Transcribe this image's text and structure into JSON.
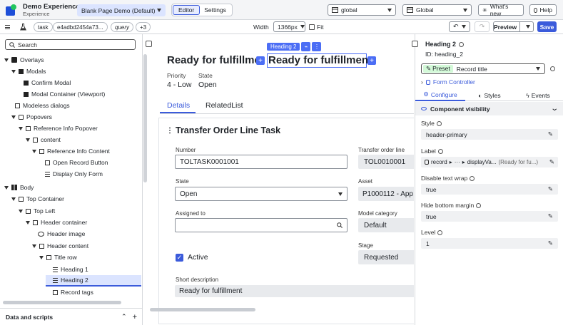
{
  "app": {
    "title": "Demo Experience",
    "subtitle": "Experience"
  },
  "page_selector": "Blank Page Demo (Default)",
  "mode_tabs": {
    "editor": "Editor",
    "settings": "Settings"
  },
  "header_right": {
    "scope_global": "global",
    "app_global": "Global",
    "whats_new": "What's new",
    "help": "Help"
  },
  "toolbar": {
    "chips": [
      "task",
      "e4adbd2454a73...",
      "query",
      "+3"
    ],
    "width_label": "Width",
    "width_value": "1366px",
    "fit_label": "Fit",
    "preview": "Preview",
    "save": "Save"
  },
  "sidebar": {
    "search_placeholder": "Search",
    "tree": [
      {
        "label": "Overlays",
        "level": 0
      },
      {
        "label": "Modals",
        "level": 1
      },
      {
        "label": "Confirm Modal",
        "level": 2
      },
      {
        "label": "Modal Container (Viewport)",
        "level": 2
      },
      {
        "label": "Modeless dialogs",
        "level": 1
      },
      {
        "label": "Popovers",
        "level": 1
      },
      {
        "label": "Reference Info Popover",
        "level": 2
      },
      {
        "label": "content",
        "level": 3
      },
      {
        "label": "Reference Info Content",
        "level": 4
      },
      {
        "label": "Open Record Button",
        "level": 5
      },
      {
        "label": "Display Only Form",
        "level": 5
      },
      {
        "label": "Body",
        "level": 0
      },
      {
        "label": "Top Container",
        "level": 1
      },
      {
        "label": "Top Left",
        "level": 2
      },
      {
        "label": "Header container",
        "level": 3
      },
      {
        "label": "Header image",
        "level": 4
      },
      {
        "label": "Header content",
        "level": 4
      },
      {
        "label": "Title row",
        "level": 5
      },
      {
        "label": "Heading 1",
        "level": 6
      },
      {
        "label": "Heading 2",
        "level": 6
      },
      {
        "label": "Record tags",
        "level": 6
      }
    ],
    "footer": "Data and scripts"
  },
  "canvas": {
    "heading_left": "Ready for fulfillme",
    "heading_selected": "Ready for fulfillment",
    "selection_tag": "Heading 2",
    "priority_label": "Priority",
    "priority_value": "4 - Low",
    "state_label": "State",
    "state_value": "Open",
    "tabs": [
      "Details",
      "RelatedList"
    ],
    "form_title": "Transfer Order Line Task",
    "fields": {
      "number_label": "Number",
      "number_value": "TOLTASK0001001",
      "transfer_label": "Transfer order line",
      "transfer_value": "TOL0010001",
      "state_label": "State",
      "state_value": "Open",
      "asset_label": "Asset",
      "asset_value": "P1000112 - App",
      "assigned_label": "Assigned to",
      "model_label": "Model category",
      "model_value": "Default",
      "stage_label": "Stage",
      "stage_value": "Requested",
      "active_label": "Active",
      "short_desc_label": "Short description",
      "short_desc_value": "Ready for fulfillment"
    }
  },
  "properties": {
    "title": "Heading 2",
    "id_label": "ID: heading_2",
    "preset_tag": "Preset",
    "preset_value": "Record title",
    "form_controller": "Form Controller",
    "tabs": [
      "Configure",
      "Styles",
      "Events"
    ],
    "section": "Component visibility",
    "style_label": "Style",
    "style_value": "header-primary",
    "label_label": "Label",
    "label_record": "record",
    "label_ellipsis": "···",
    "label_display": "displayVa...",
    "label_preview": "(Ready for fu...)",
    "wrap_label": "Disable text wrap",
    "wrap_value": "true",
    "margin_label": "Hide bottom margin",
    "margin_value": "true",
    "level_label": "Level",
    "level_value": "1"
  },
  "colors": {
    "accent": "#3b5bdb",
    "save_bg": "#3b5bdb",
    "selection": "#4c6ef5"
  }
}
